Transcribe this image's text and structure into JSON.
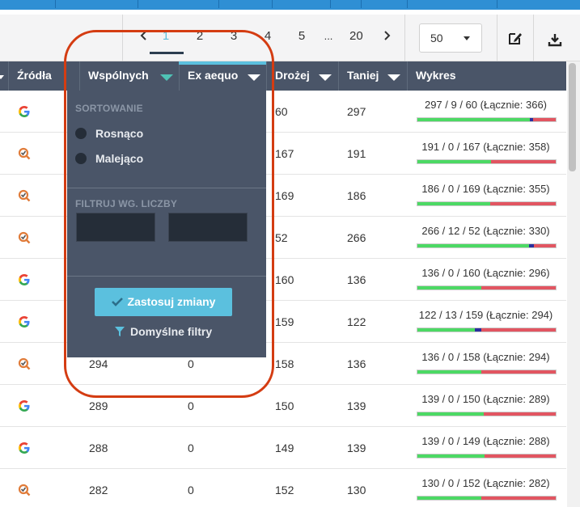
{
  "pagination": {
    "prev_icon": "chevron-left-icon",
    "next_icon": "chevron-right-icon",
    "pages": [
      "1",
      "2",
      "3",
      "4",
      "5",
      "...",
      "20"
    ],
    "active_page": "1"
  },
  "per_page": {
    "value": "50"
  },
  "tools": {
    "edit_icon": "edit-icon",
    "download_icon": "download-icon"
  },
  "table": {
    "headers": {
      "sources": "Źródła",
      "common": "Wspólnych",
      "ex_aequo": "Ex aequo",
      "more_expensive": "Drożej",
      "cheaper": "Taniej",
      "chart": "Wykres"
    },
    "rows": [
      {
        "source": "google",
        "common": "",
        "ex_aequo": "",
        "drozej": "60",
        "taniej": "297",
        "label": "297 / 9 / 60 (Łącznie: 366)",
        "green": 297,
        "blue": 9,
        "red": 60
      },
      {
        "source": "ceneo",
        "common": "",
        "ex_aequo": "",
        "drozej": "167",
        "taniej": "191",
        "label": "191 / 0 / 167 (Łącznie: 358)",
        "green": 191,
        "blue": 0,
        "red": 167
      },
      {
        "source": "ceneo",
        "common": "",
        "ex_aequo": "",
        "drozej": "169",
        "taniej": "186",
        "label": "186 / 0 / 169 (Łącznie: 355)",
        "green": 186,
        "blue": 0,
        "red": 169
      },
      {
        "source": "ceneo",
        "common": "",
        "ex_aequo": "",
        "drozej": "52",
        "taniej": "266",
        "label": "266 / 12 / 52 (Łącznie: 330)",
        "green": 266,
        "blue": 12,
        "red": 52
      },
      {
        "source": "google",
        "common": "",
        "ex_aequo": "",
        "drozej": "160",
        "taniej": "136",
        "label": "136 / 0 / 160 (Łącznie: 296)",
        "green": 136,
        "blue": 0,
        "red": 160
      },
      {
        "source": "google",
        "common": "",
        "ex_aequo": "",
        "drozej": "159",
        "taniej": "122",
        "label": "122 / 13 / 159 (Łącznie: 294)",
        "green": 122,
        "blue": 13,
        "red": 159
      },
      {
        "source": "ceneo",
        "common": "294",
        "ex_aequo": "0",
        "drozej": "158",
        "taniej": "136",
        "label": "136 / 0 / 158 (Łącznie: 294)",
        "green": 136,
        "blue": 0,
        "red": 158
      },
      {
        "source": "google",
        "common": "289",
        "ex_aequo": "0",
        "drozej": "150",
        "taniej": "139",
        "label": "139 / 0 / 150 (Łącznie: 289)",
        "green": 139,
        "blue": 0,
        "red": 150
      },
      {
        "source": "google",
        "common": "288",
        "ex_aequo": "0",
        "drozej": "149",
        "taniej": "139",
        "label": "139 / 0 / 149 (Łącznie: 288)",
        "green": 139,
        "blue": 0,
        "red": 149
      },
      {
        "source": "ceneo",
        "common": "282",
        "ex_aequo": "0",
        "drozej": "152",
        "taniej": "130",
        "label": "130 / 0 / 152 (Łącznie: 282)",
        "green": 130,
        "blue": 0,
        "red": 152
      }
    ]
  },
  "dropdown": {
    "sort_title": "SORTOWANIE",
    "asc": "Rosnąco",
    "desc": "Malejąco",
    "filter_title": "FILTRUJ WG. LICZBY",
    "min_value": "",
    "max_value": "",
    "apply": "Zastosuj zmiany",
    "defaults": "Domyślne filtry"
  },
  "colors": {
    "accent": "#5bc0de",
    "header_bg": "#4a5568",
    "bar_green": "#4cd964",
    "bar_blue": "#2a2f9e",
    "bar_red": "#e25561",
    "highlight": "#d43c12"
  }
}
